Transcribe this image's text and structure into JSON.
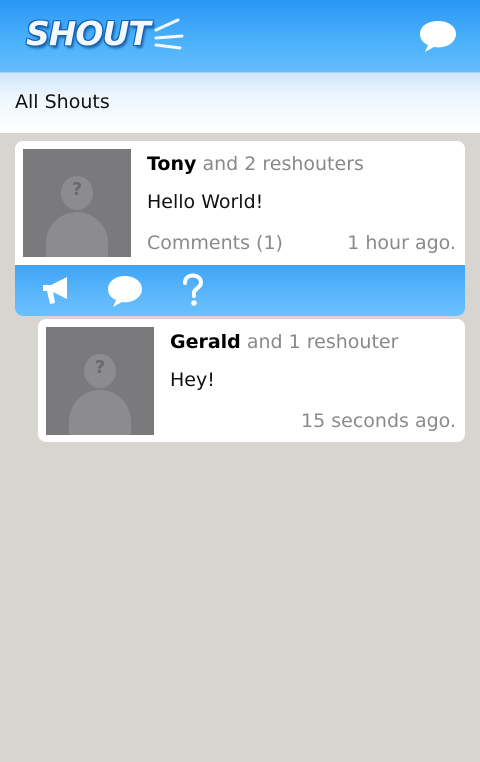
{
  "app": {
    "logo_text": "SHOUT"
  },
  "section": {
    "title": "All Shouts"
  },
  "shouts": [
    {
      "author": "Tony",
      "reshout_text": "and 2 reshouters",
      "message": "Hello World!",
      "comments_label": "Comments (1)",
      "time": "1 hour ago."
    }
  ],
  "replies": [
    {
      "author": "Gerald",
      "reshout_text": "and 1 reshouter",
      "message": "Hey!",
      "time": "15 seconds ago."
    }
  ],
  "icons": {
    "compose": "chat-bubble-icon",
    "reshout": "megaphone-icon",
    "comment": "comment-bubble-icon",
    "help": "question-mark-icon",
    "avatar": "avatar-placeholder-icon"
  },
  "colors": {
    "appbar": "#2a97f5",
    "background": "#d8d5d1",
    "avatar": "#7a7a7c"
  }
}
